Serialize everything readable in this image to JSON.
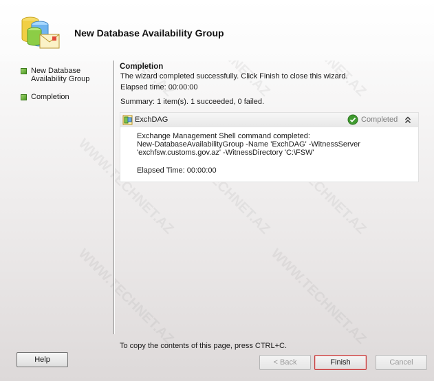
{
  "window": {
    "title": "New Database Availability Group",
    "watermark": "WWW.TECHNET.AZ"
  },
  "nav": {
    "items": [
      {
        "label": "New Database Availability Group"
      },
      {
        "label": "Completion"
      }
    ]
  },
  "main": {
    "section_title": "Completion",
    "message": "The wizard completed successfully. Click Finish to close this wizard.",
    "elapsed": "Elapsed time: 00:00:00",
    "summary": "Summary: 1 item(s). 1 succeeded, 0 failed."
  },
  "result": {
    "name": "ExchDAG",
    "status": "Completed",
    "lines": [
      "Exchange Management Shell command completed:",
      "New-DatabaseAvailabilityGroup -Name 'ExchDAG' -WitnessServer",
      "'exchfsw.customs.gov.az' -WitnessDirectory 'C:\\FSW'"
    ],
    "elapsed": "Elapsed Time: 00:00:00"
  },
  "footer": {
    "note": "To copy the contents of this page, press CTRL+C.",
    "help_label": "Help",
    "back_label": "< Back",
    "finish_label": "Finish",
    "cancel_label": "Cancel"
  },
  "colors": {
    "accent_green": "#4d9a25",
    "status_gray": "#7b7b7b",
    "focus_red": "#c43a3a"
  }
}
